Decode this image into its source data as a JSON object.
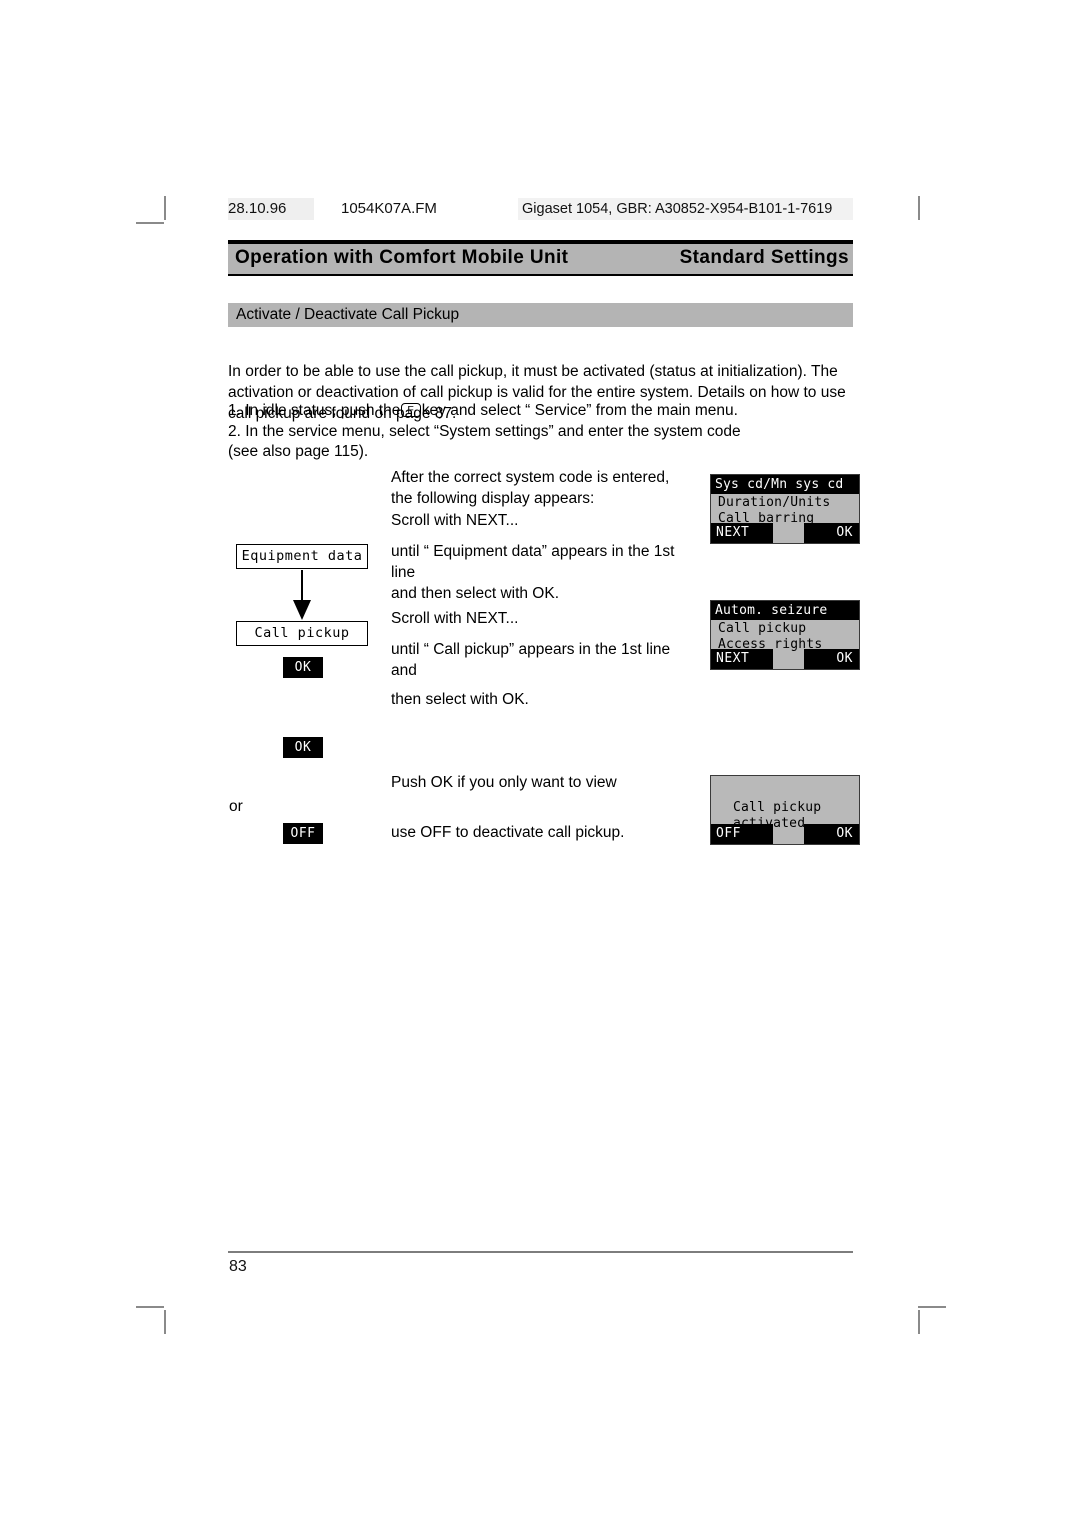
{
  "print_header": {
    "date": "28.10.96",
    "filename": "1054K07A.FM",
    "doc_id": "Gigaset 1054, GBR: A30852-X954-B101-1-7619"
  },
  "running_head": {
    "left": "Operation with Comfort Mobile Unit",
    "right": "Standard Settings"
  },
  "section": {
    "heading": "Activate / Deactivate Call Pickup"
  },
  "body": {
    "intro": "In order to be able to use the call pickup, it must be activated (status at initialization). The activation or deactivation of call pickup is valid for the entire system. Details on how to use call pickup are found on page 87.",
    "step1_before": "1. In idle status, push the",
    "fkey_label": "F",
    "step1_after": "key and select “ Service” from the main menu.",
    "step2": "2. In the service menu, select “System settings” and enter the system code",
    "step2_cont": "(see also page 115)."
  },
  "instructions": {
    "i1_line1": "After the correct system code is entered,",
    "i1_line2": "the following display appears:",
    "i2": "Scroll with NEXT...",
    "i3_line1": "until “ Equipment data” appears in the 1st",
    "i3_line2": "line",
    "i3_line3": "and then select with OK.",
    "i4": "Scroll with NEXT...",
    "i5_line1": "until “ Call pickup” appears in the 1st line",
    "i5_line2": "and",
    "i6": "then select with OK.",
    "i7": "Push OK if you only want to view",
    "or": "or",
    "i8": "use OFF to deactivate call pickup."
  },
  "flow": {
    "box1": "Equipment data",
    "box2": "Call pickup",
    "ok1": "OK",
    "ok2": "OK",
    "off1": "OFF"
  },
  "displays": [
    {
      "title": "Sys cd/Mn sys cd",
      "line1": "Duration/Units",
      "line2": "Call barring",
      "soft_left": "NEXT",
      "soft_right": "OK"
    },
    {
      "title": "Autom. seizure",
      "line1": "Call pickup",
      "line2": "Access rights",
      "soft_left": "NEXT",
      "soft_right": "OK"
    },
    {
      "title": "",
      "line1": "Call pickup",
      "line2": "activated",
      "soft_left": "OFF",
      "soft_right": "OK"
    }
  ],
  "footer": {
    "page_number": "83"
  },
  "colors": {
    "band_gray": "#b4b4b4",
    "lcd_gray": "#b9b9b9",
    "rule_black": "#000000",
    "footer_rule": "#7d7d7d"
  }
}
